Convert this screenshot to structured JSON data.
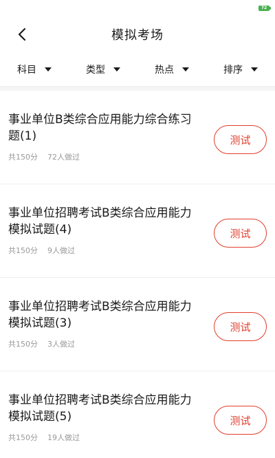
{
  "status_bar": {
    "battery": "72"
  },
  "header": {
    "title": "模拟考场",
    "back_icon": "chevron-left-icon"
  },
  "filters": [
    {
      "label": "科目",
      "icon": "caret-down-icon"
    },
    {
      "label": "类型",
      "icon": "caret-down-icon"
    },
    {
      "label": "热点",
      "icon": "caret-down-icon"
    },
    {
      "label": "排序",
      "icon": "caret-down-icon"
    }
  ],
  "exams": [
    {
      "title": "事业单位B类综合应用能力综合练习题(1)",
      "score": "共150分",
      "takers": "72人做过",
      "button": "测试"
    },
    {
      "title": "事业单位招聘考试B类综合应用能力模拟试题(4)",
      "score": "共150分",
      "takers": "9人做过",
      "button": "测试"
    },
    {
      "title": "事业单位招聘考试B类综合应用能力模拟试题(3)",
      "score": "共150分",
      "takers": "3人做过",
      "button": "测试"
    },
    {
      "title": "事业单位招聘考试B类综合应用能力模拟试题(5)",
      "score": "共150分",
      "takers": "19人做过",
      "button": "测试"
    }
  ],
  "colors": {
    "accent": "#e23c2b",
    "meta": "#999999",
    "battery": "#4caf50"
  }
}
